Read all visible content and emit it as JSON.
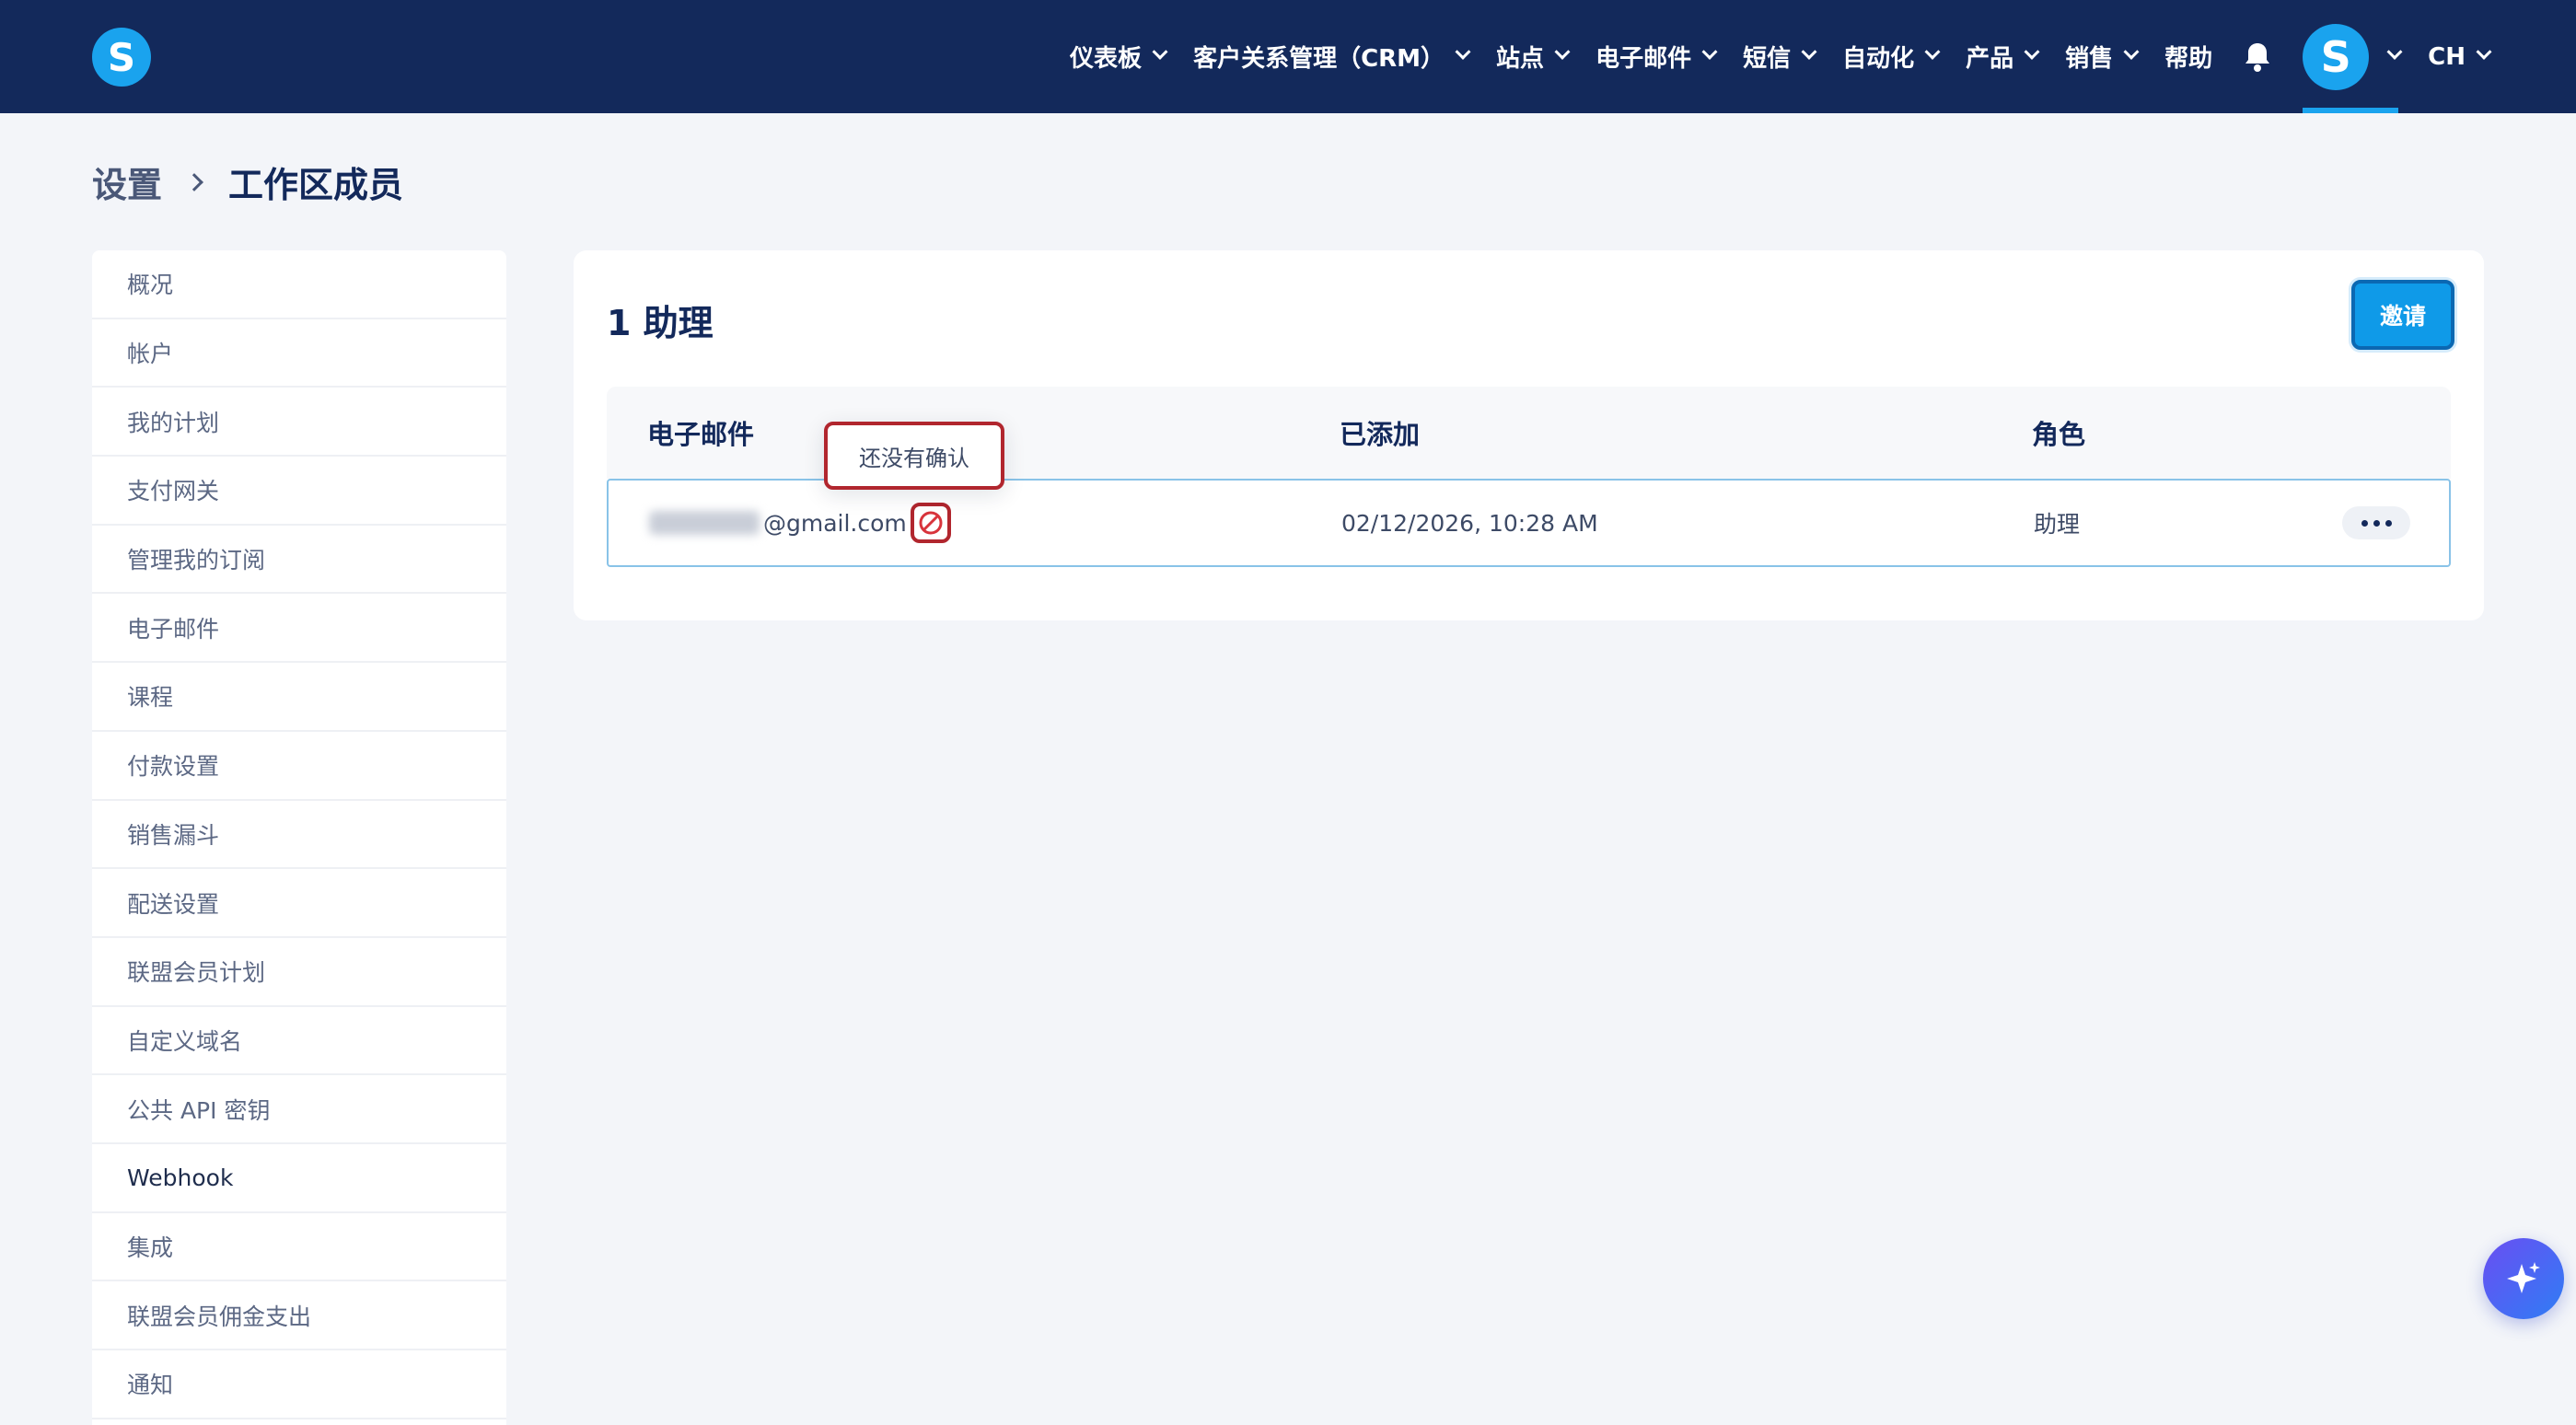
{
  "header": {
    "logo_letter": "S",
    "nav": [
      {
        "label": "仪表板",
        "has_dropdown": true
      },
      {
        "label": "客户关系管理（CRM）",
        "has_dropdown": true
      },
      {
        "label": "站点",
        "has_dropdown": true
      },
      {
        "label": "电子邮件",
        "has_dropdown": true
      },
      {
        "label": "短信",
        "has_dropdown": true
      },
      {
        "label": "自动化",
        "has_dropdown": true
      },
      {
        "label": "产品",
        "has_dropdown": true
      },
      {
        "label": "销售",
        "has_dropdown": true
      },
      {
        "label": "帮助",
        "has_dropdown": false
      }
    ],
    "notification_icon": "bell-icon",
    "avatar_letter": "S",
    "language": "CH",
    "colors": {
      "background": "#13295b",
      "accent": "#1aa3ee"
    }
  },
  "breadcrumb": {
    "parent": "设置",
    "current": "工作区成员"
  },
  "sidebar": {
    "items": [
      {
        "label": "概况"
      },
      {
        "label": "帐户"
      },
      {
        "label": "我的计划"
      },
      {
        "label": "支付网关"
      },
      {
        "label": "管理我的订阅"
      },
      {
        "label": "电子邮件"
      },
      {
        "label": "课程"
      },
      {
        "label": "付款设置"
      },
      {
        "label": "销售漏斗"
      },
      {
        "label": "配送设置"
      },
      {
        "label": "联盟会员计划"
      },
      {
        "label": "自定义域名"
      },
      {
        "label": "公共 API 密钥"
      },
      {
        "label": "Webhook"
      },
      {
        "label": "集成"
      },
      {
        "label": "联盟会员佣金支出"
      },
      {
        "label": "通知"
      }
    ]
  },
  "main": {
    "title": "1 助理",
    "invite_label": "邀请",
    "table": {
      "columns": [
        "电子邮件",
        "已添加",
        "角色"
      ],
      "rows": [
        {
          "email_domain": "@gmail.com",
          "status_icon": "ban-icon",
          "added": "02/12/2026, 10:28 AM",
          "role": "助理"
        }
      ]
    },
    "tooltip": "还没有确认"
  },
  "fab": {
    "icon": "sparkle-icon",
    "colors": [
      "#6a4ef2",
      "#2f7df5"
    ]
  }
}
